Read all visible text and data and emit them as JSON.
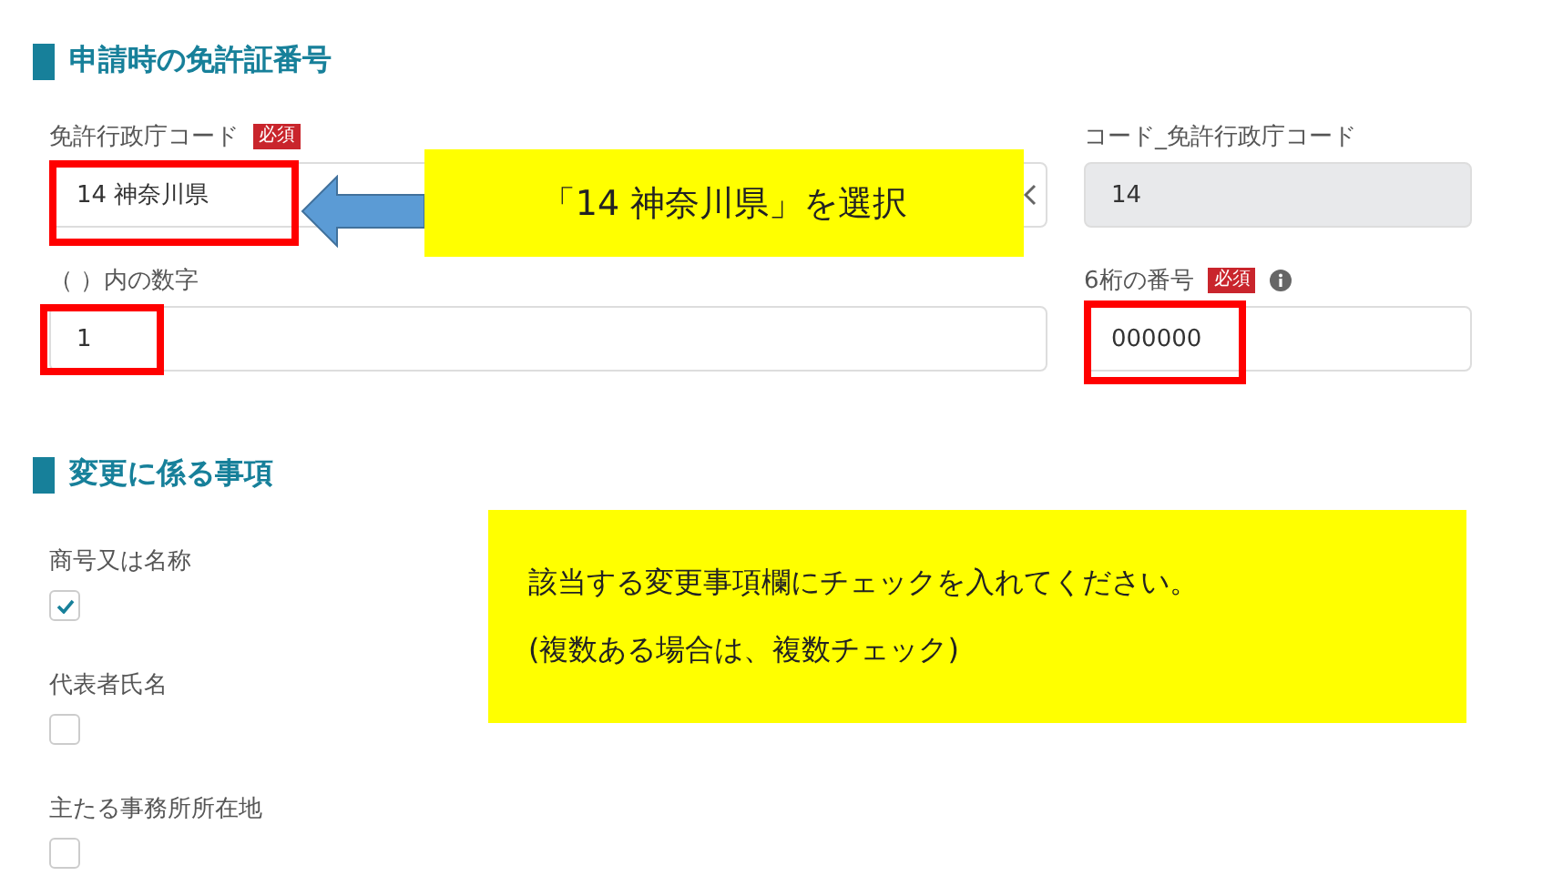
{
  "sections": [
    {
      "title": "申請時の免許証番号",
      "kind": "fields",
      "rows": [
        [
          {
            "label": "免許行政庁コード",
            "required": "必須",
            "value": "14 神奈川県",
            "kind": "select"
          },
          {
            "label": "コード_免許行政庁コード",
            "value": "14",
            "kind": "readonly"
          }
        ],
        [
          {
            "label": "（ ）内の数字",
            "value": "1",
            "kind": "input"
          },
          {
            "label": "6桁の番号",
            "required": "必須",
            "info": true,
            "value": "000000",
            "kind": "input"
          }
        ]
      ]
    },
    {
      "title": "変更に係る事項",
      "kind": "checks",
      "items": [
        {
          "label": "商号又は名称",
          "checked": true
        },
        {
          "label": "代表者氏名",
          "checked": false
        },
        {
          "label": "主たる事務所所在地",
          "checked": false
        }
      ]
    }
  ],
  "callouts": [
    {
      "lines": [
        "「14 神奈川県」を選択"
      ]
    },
    {
      "lines": [
        "該当する変更事項欄にチェックを入れてください。",
        "(複数ある場合は、複数チェック)"
      ]
    }
  ]
}
